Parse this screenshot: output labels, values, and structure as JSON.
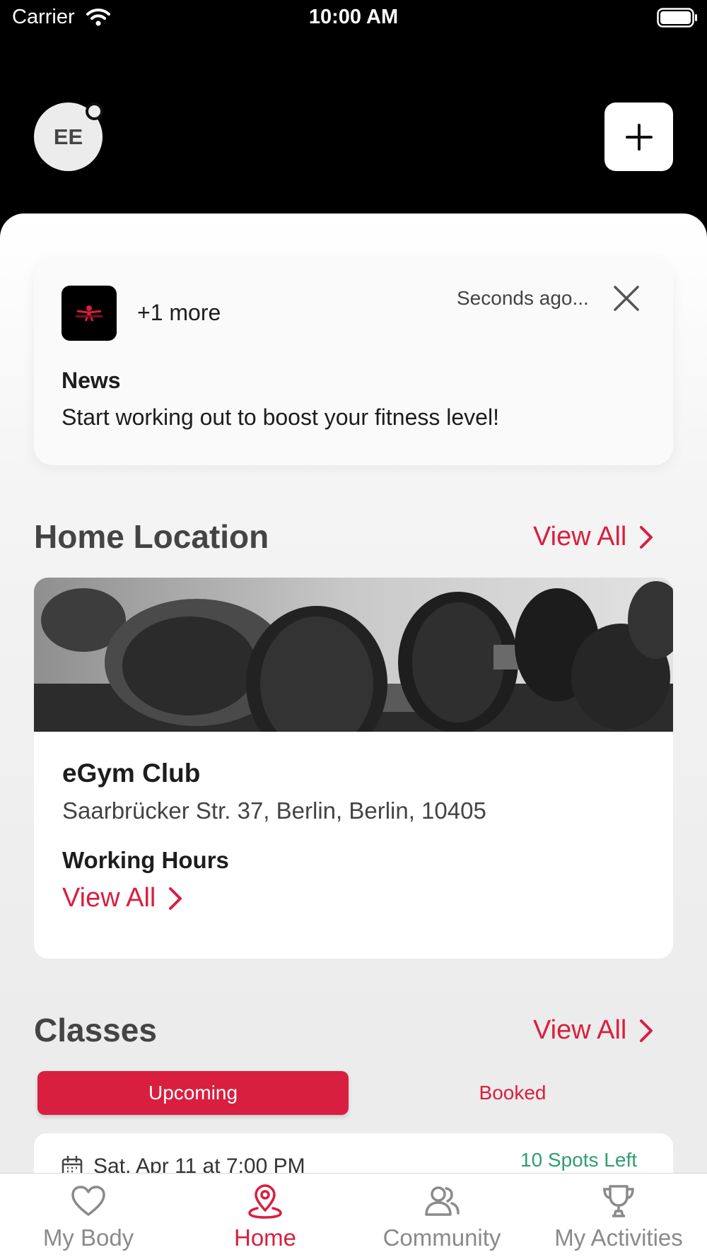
{
  "status_bar": {
    "carrier": "Carrier",
    "time": "10:00 AM"
  },
  "header": {
    "avatar_initials": "EE"
  },
  "news_card": {
    "more": "+1 more",
    "time": "Seconds ago...",
    "heading": "News",
    "body": "Start working out to boost your fitness level!"
  },
  "home_location": {
    "title": "Home Location",
    "view_all": "View All",
    "club_name": "eGym Club",
    "address": "Saarbrücker Str. 37, Berlin, Berlin, 10405",
    "hours_label": "Working Hours",
    "hours_view_all": "View All"
  },
  "classes": {
    "title": "Classes",
    "view_all": "View All",
    "tabs": [
      {
        "label": "Upcoming",
        "active": true
      },
      {
        "label": "Booked",
        "active": false
      }
    ],
    "items": [
      {
        "date": "Sat, Apr 11 at 7:00 PM",
        "spots": "10 Spots Left"
      }
    ]
  },
  "tab_bar": {
    "items": [
      {
        "label": "My Body",
        "icon": "heart-icon",
        "active": false
      },
      {
        "label": "Home",
        "icon": "home-pin-icon",
        "active": true
      },
      {
        "label": "Community",
        "icon": "community-icon",
        "active": false
      },
      {
        "label": "My Activities",
        "icon": "trophy-icon",
        "active": false
      }
    ]
  },
  "colors": {
    "accent": "#d81f3f",
    "success": "#2e9e6f",
    "header_bg": "#000000"
  }
}
